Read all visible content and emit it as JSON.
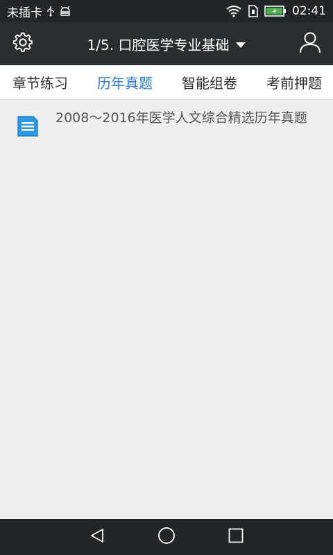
{
  "status_bar": {
    "carrier": "未插卡",
    "time": "02:41",
    "icons": [
      "usb-icon",
      "android-debug-icon",
      "wifi-icon",
      "sim-icon",
      "battery-charging-icon"
    ]
  },
  "header": {
    "settings_icon": "gear-icon",
    "title": "1/5. 口腔医学专业基础",
    "dropdown_icon": "caret-down-icon",
    "profile_icon": "user-icon"
  },
  "tabs": [
    {
      "label": "章节练习",
      "active": false
    },
    {
      "label": "历年真题",
      "active": true
    },
    {
      "label": "智能组卷",
      "active": false
    },
    {
      "label": "考前押题",
      "active": false
    }
  ],
  "list": [
    {
      "icon": "document-icon",
      "title": "2008～2016年医学人文综合精选历年真题"
    }
  ],
  "nav": {
    "back_icon": "back-triangle-icon",
    "home_icon": "home-circle-icon",
    "recents_icon": "recents-square-icon"
  },
  "colors": {
    "header_bg": "#2a2e31",
    "status_bg": "#222629",
    "active_tab": "#2a7fd4",
    "content_bg": "#efefef",
    "doc_icon": "#2b9be8"
  }
}
